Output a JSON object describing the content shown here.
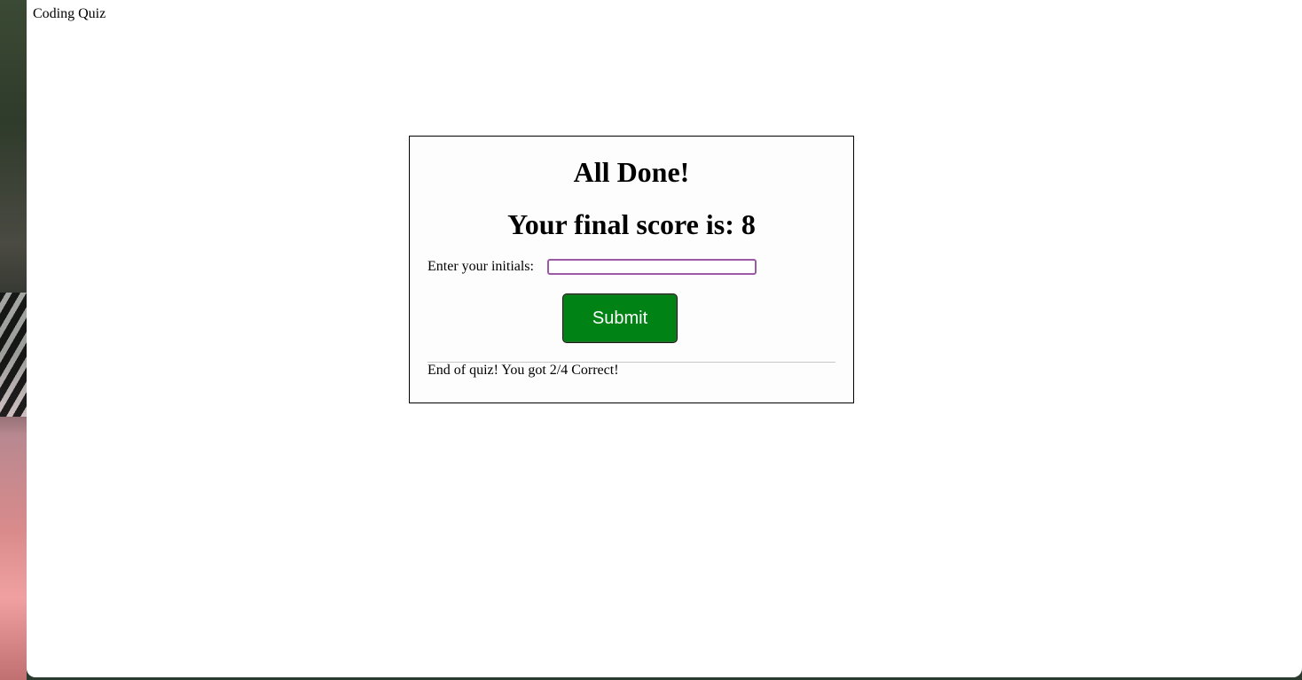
{
  "app": {
    "title": "Coding Quiz"
  },
  "quiz": {
    "heading": "All Done!",
    "score_text": "Your final score is: 8",
    "initials_label": "Enter your initials:",
    "initials_value": "",
    "initials_placeholder": "",
    "submit_label": "Submit",
    "result_text": "End of quiz! You got 2/4 Correct!"
  },
  "colors": {
    "submit_background": "#008214",
    "submit_text": "#ffffff",
    "input_border": "#9b59a6",
    "card_border": "#000000"
  }
}
